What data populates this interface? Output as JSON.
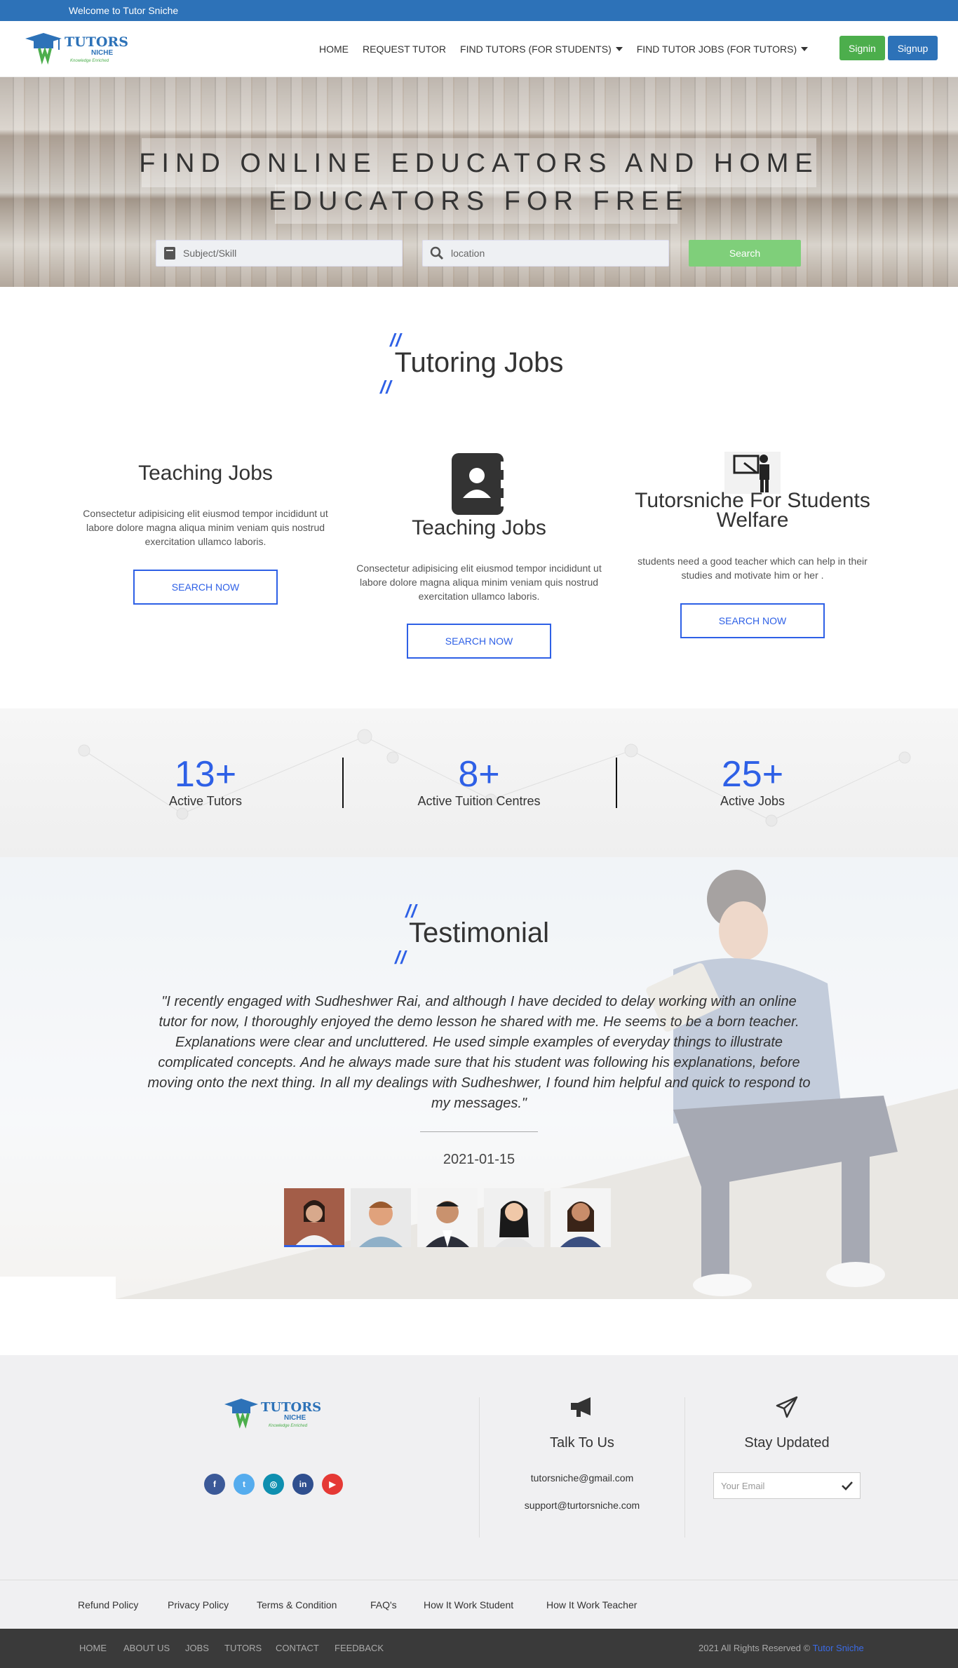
{
  "topbar": {
    "welcome": "Welcome to Tutor Sniche"
  },
  "logo": {
    "name": "TUTORS",
    "sub": "NICHE",
    "tagline": "Knowledge Enriched"
  },
  "nav": {
    "items": [
      {
        "label": "HOME"
      },
      {
        "label": "REQUEST TUTOR"
      },
      {
        "label": "FIND TUTORS (FOR STUDENTS)",
        "dropdown": true
      },
      {
        "label": "FIND TUTOR JOBS (FOR TUTORS)",
        "dropdown": true
      }
    ],
    "signin": "Signin",
    "signup": "Signup"
  },
  "hero": {
    "title_line1": "FIND ONLINE EDUCATORS AND HOME",
    "title_line2": "EDUCATORS FOR FREE",
    "subject_placeholder": "Subject/Skill",
    "location_placeholder": "location",
    "search_label": "Search"
  },
  "jobs": {
    "slash": "//",
    "title": "Tutoring Jobs",
    "cards": [
      {
        "title": "Teaching Jobs",
        "text": "Consectetur adipisicing elit eiusmod tempor incididunt ut labore dolore magna aliqua minim veniam quis nostrud exercitation ullamco laboris.",
        "button": "SEARCH NOW",
        "icon": "none"
      },
      {
        "title": "Teaching Jobs",
        "text": "Consectetur adipisicing elit eiusmod tempor incididunt ut labore dolore magna aliqua minim veniam quis nostrud exercitation ullamco laboris.",
        "button": "SEARCH NOW",
        "icon": "contact-book-icon"
      },
      {
        "title": "Tutorsniche For Students Welfare",
        "text": "students need a good teacher which can help in their studies and motivate him or her .",
        "button": "SEARCH NOW",
        "icon": "teacher-board-icon"
      }
    ]
  },
  "stats": [
    {
      "num": "13+",
      "label": "Active Tutors"
    },
    {
      "num": "8+",
      "label": "Active Tuition Centres"
    },
    {
      "num": "25+",
      "label": "Active Jobs"
    }
  ],
  "testimonial": {
    "slash": "//",
    "title": "Testimonial",
    "quote": "\"I recently engaged with Sudheshwer Rai, and although I have decided to delay working with an online tutor for now, I thoroughly enjoyed the demo lesson he shared with me. He seems to be a born teacher. Explanations were clear and uncluttered. He used simple examples of everyday things to illustrate complicated concepts. And he always made sure that his student was following his explanations, before moving onto the next thing. In all my dealings with Sudheshwer, I found him helpful and quick to respond to my messages.\"",
    "date": "2021-01-15"
  },
  "footer": {
    "talk_title": "Talk To Us",
    "email1": "tutorsniche@gmail.com",
    "email2": "support@turtorsniche.com",
    "stay_title": "Stay Updated",
    "email_placeholder": "Your Email",
    "social": [
      {
        "icon": "facebook-icon",
        "glyph": "f",
        "color": "#3b5998"
      },
      {
        "icon": "twitter-icon",
        "glyph": "t",
        "color": "#55acee"
      },
      {
        "icon": "instagram-icon",
        "glyph": "◎",
        "color": "#0e8fb0"
      },
      {
        "icon": "linkedin-icon",
        "glyph": "in",
        "color": "#2f4f8f"
      },
      {
        "icon": "youtube-icon",
        "glyph": "▶",
        "color": "#e53935"
      }
    ],
    "links": [
      "Refund Policy",
      "Privacy Policy",
      "Terms & Condition",
      "FAQ's",
      "How It Work Student",
      "How It Work Teacher"
    ],
    "bottom_nav": [
      "HOME",
      "ABOUT US",
      "JOBS",
      "TUTORS",
      "CONTACT",
      "FEEDBACK"
    ],
    "copyright": "2021 All Rights Reserved ©",
    "brand": "Tutor Sniche"
  },
  "colors": {
    "primary": "#2d72b8",
    "accent": "#2e60e6",
    "green": "#4cae4c"
  }
}
